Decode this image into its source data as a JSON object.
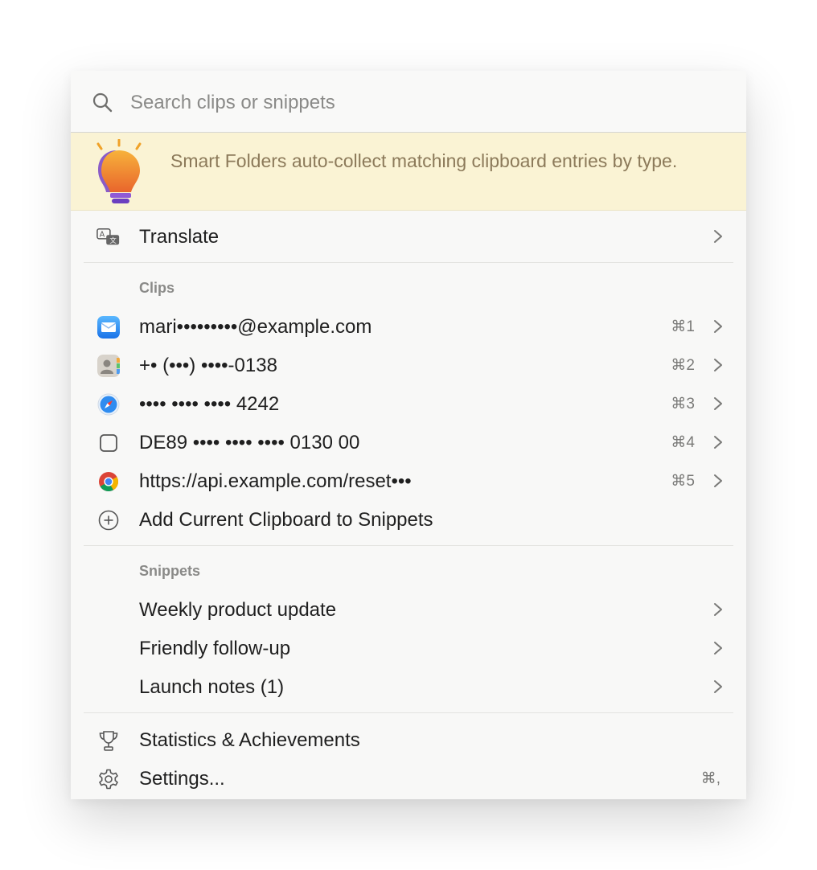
{
  "search": {
    "placeholder": "Search clips or snippets"
  },
  "tip": {
    "text": "Smart Folders auto-collect matching clipboard entries by type."
  },
  "translate": {
    "label": "Translate"
  },
  "clips": {
    "header": "Clips",
    "items": [
      {
        "label": "mari•••••••••@example.com",
        "shortcut": "⌘1",
        "icon": "mail-icon"
      },
      {
        "label": "+• (•••) ••••-0138",
        "shortcut": "⌘2",
        "icon": "contacts-icon"
      },
      {
        "label": "•••• •••• •••• 4242",
        "shortcut": "⌘3",
        "icon": "safari-icon"
      },
      {
        "label": "DE89 •••• •••• •••• 0130 00",
        "shortcut": "⌘4",
        "icon": "text-clip-icon"
      },
      {
        "label": "https://api.example.com/reset•••",
        "shortcut": "⌘5",
        "icon": "chrome-icon"
      }
    ],
    "add_label": "Add Current Clipboard to Snippets"
  },
  "snippets": {
    "header": "Snippets",
    "items": [
      {
        "label": "Weekly product update"
      },
      {
        "label": "Friendly follow-up"
      },
      {
        "label": "Launch notes (1)"
      }
    ]
  },
  "footer": {
    "stats_label": "Statistics & Achievements",
    "settings_label": "Settings...",
    "settings_shortcut": "⌘,"
  }
}
